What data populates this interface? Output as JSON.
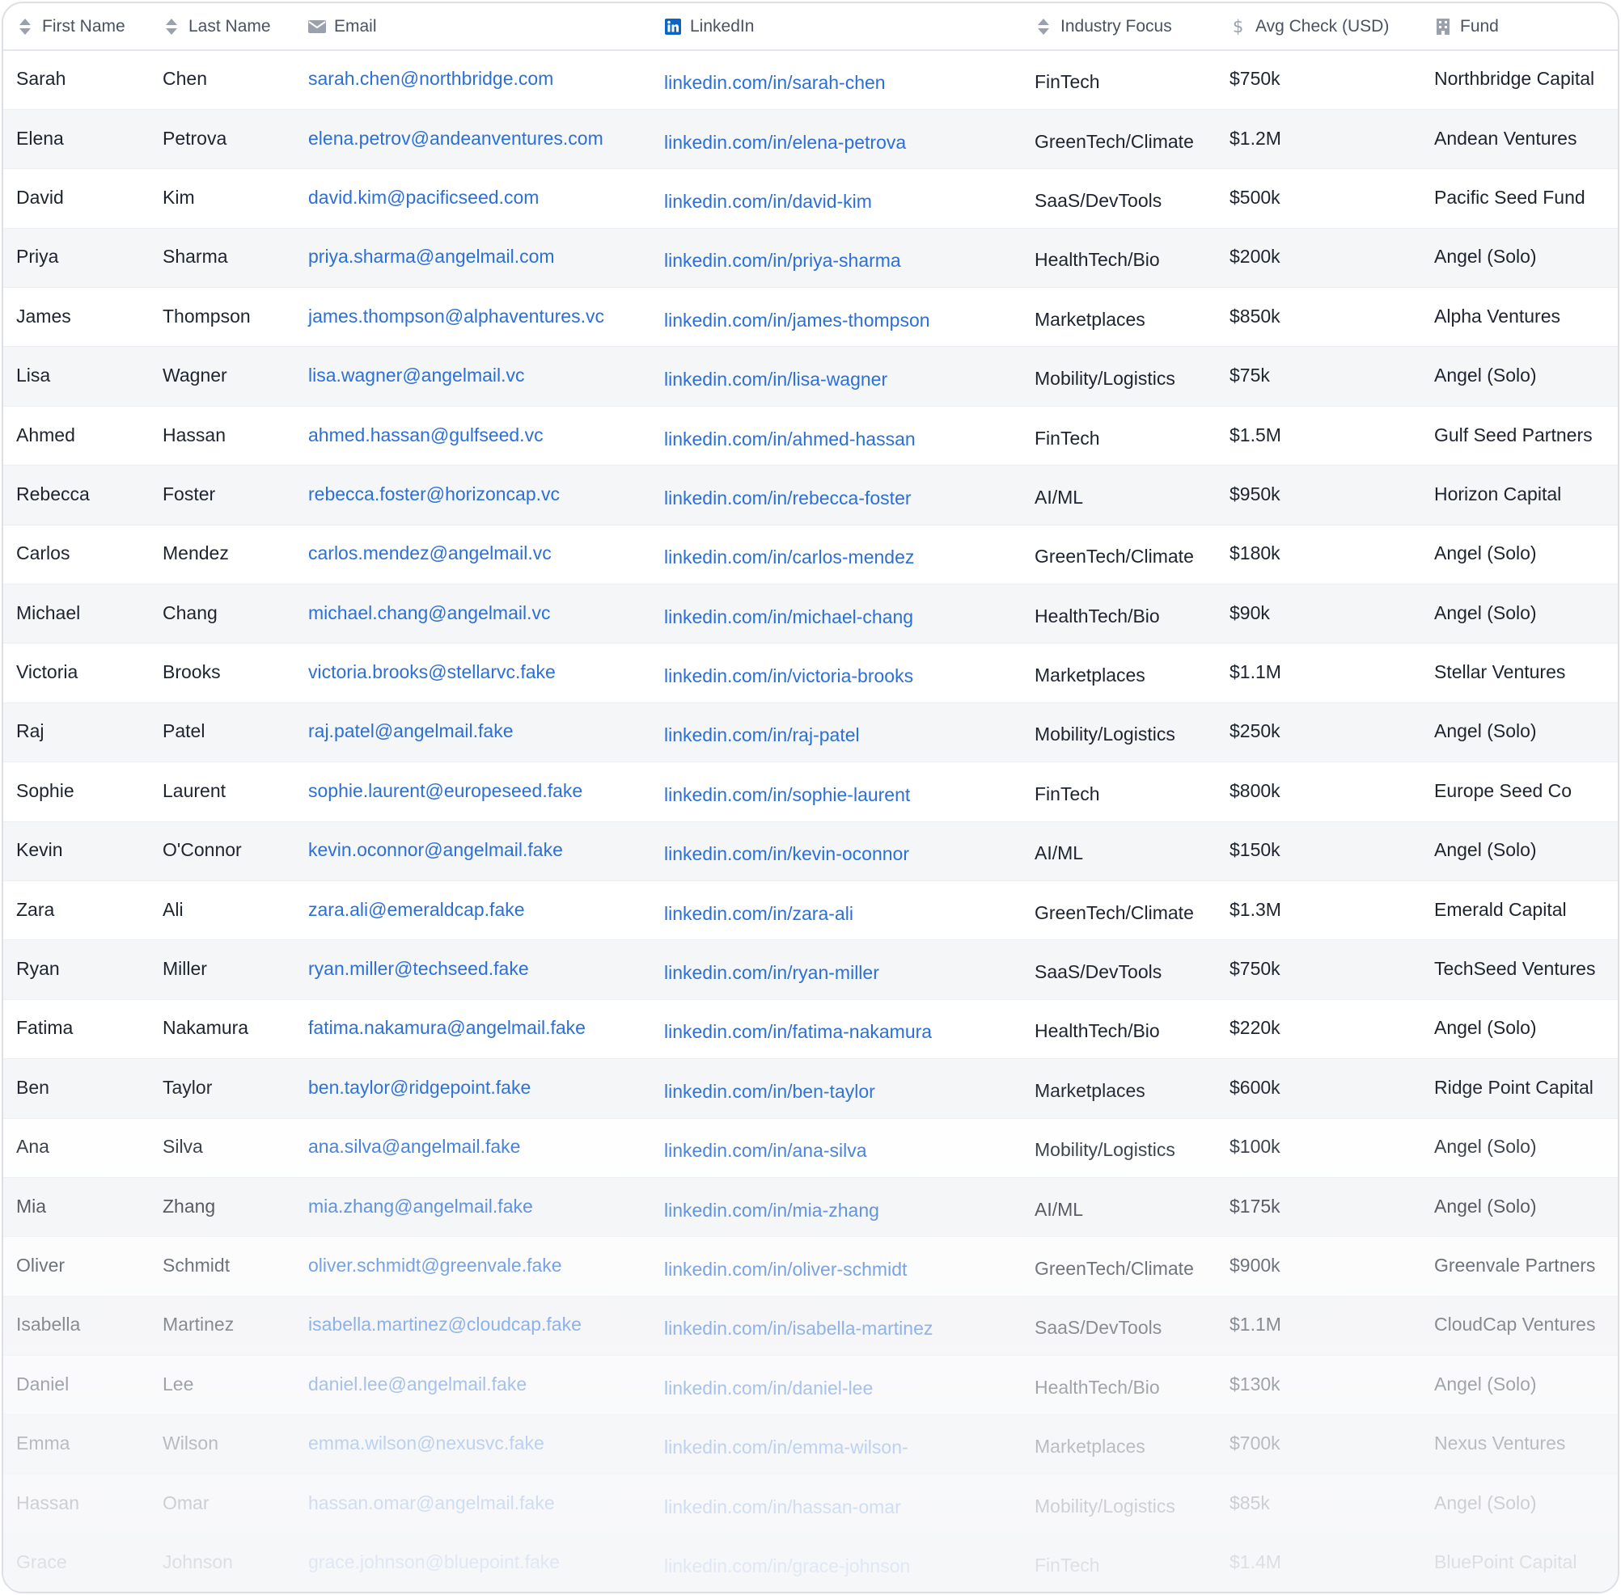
{
  "columns": {
    "first_name": "First Name",
    "last_name": "Last Name",
    "email": "Email",
    "linkedin": "LinkedIn",
    "industry": "Industry Focus",
    "avg_check": "Avg Check (USD)",
    "fund": "Fund"
  },
  "icons": {
    "first_name": "sort-icon",
    "last_name": "sort-icon",
    "email": "envelope-icon",
    "linkedin": "linkedin-icon",
    "industry": "sort-icon",
    "avg_check": "dollar-icon",
    "fund": "building-icon"
  },
  "colors": {
    "link": "#2c6fd6",
    "linkedin_brand": "#0a66c2",
    "header_text": "#4a5260",
    "row_stripe": "#f5f6f8"
  },
  "rows": [
    {
      "first": "Sarah",
      "last": "Chen",
      "email": "sarah.chen@northbridge.com",
      "linkedin": "linkedin.com/in/sarah-chen",
      "industry": "FinTech",
      "avg": "$750k",
      "fund": "Northbridge Capital"
    },
    {
      "first": "Elena",
      "last": "Petrova",
      "email": "elena.petrov@andeanventures.com",
      "linkedin": "linkedin.com/in/elena-petrova",
      "industry": "GreenTech/Climate",
      "avg": "$1.2M",
      "fund": "Andean Ventures"
    },
    {
      "first": "David",
      "last": "Kim",
      "email": "david.kim@pacificseed.com",
      "linkedin": "linkedin.com/in/david-kim",
      "industry": "SaaS/DevTools",
      "avg": "$500k",
      "fund": "Pacific Seed Fund"
    },
    {
      "first": "Priya",
      "last": "Sharma",
      "email": "priya.sharma@angelmail.com",
      "linkedin": "linkedin.com/in/priya-sharma",
      "industry": "HealthTech/Bio",
      "avg": "$200k",
      "fund": "Angel (Solo)"
    },
    {
      "first": "James",
      "last": "Thompson",
      "email": "james.thompson@alphaventures.vc",
      "linkedin": "linkedin.com/in/james-thompson",
      "industry": "Marketplaces",
      "avg": "$850k",
      "fund": "Alpha Ventures"
    },
    {
      "first": "Lisa",
      "last": "Wagner",
      "email": "lisa.wagner@angelmail.vc",
      "linkedin": "linkedin.com/in/lisa-wagner",
      "industry": "Mobility/Logistics",
      "avg": "$75k",
      "fund": "Angel (Solo)"
    },
    {
      "first": "Ahmed",
      "last": "Hassan",
      "email": "ahmed.hassan@gulfseed.vc",
      "linkedin": "linkedin.com/in/ahmed-hassan",
      "industry": "FinTech",
      "avg": "$1.5M",
      "fund": "Gulf Seed Partners"
    },
    {
      "first": "Rebecca",
      "last": "Foster",
      "email": "rebecca.foster@horizoncap.vc",
      "linkedin": "linkedin.com/in/rebecca-foster",
      "industry": "AI/ML",
      "avg": "$950k",
      "fund": "Horizon Capital"
    },
    {
      "first": "Carlos",
      "last": "Mendez",
      "email": "carlos.mendez@angelmail.vc",
      "linkedin": "linkedin.com/in/carlos-mendez",
      "industry": "GreenTech/Climate",
      "avg": "$180k",
      "fund": "Angel (Solo)"
    },
    {
      "first": "Michael",
      "last": "Chang",
      "email": "michael.chang@angelmail.vc",
      "linkedin": "linkedin.com/in/michael-chang",
      "industry": "HealthTech/Bio",
      "avg": "$90k",
      "fund": "Angel (Solo)"
    },
    {
      "first": "Victoria",
      "last": "Brooks",
      "email": "victoria.brooks@stellarvc.fake",
      "linkedin": "linkedin.com/in/victoria-brooks",
      "industry": "Marketplaces",
      "avg": "$1.1M",
      "fund": "Stellar Ventures"
    },
    {
      "first": "Raj",
      "last": "Patel",
      "email": "raj.patel@angelmail.fake",
      "linkedin": "linkedin.com/in/raj-patel",
      "industry": "Mobility/Logistics",
      "avg": "$250k",
      "fund": "Angel (Solo)"
    },
    {
      "first": "Sophie",
      "last": "Laurent",
      "email": "sophie.laurent@europeseed.fake",
      "linkedin": "linkedin.com/in/sophie-laurent",
      "industry": "FinTech",
      "avg": "$800k",
      "fund": "Europe Seed Co"
    },
    {
      "first": "Kevin",
      "last": "O'Connor",
      "email": "kevin.oconnor@angelmail.fake",
      "linkedin": "linkedin.com/in/kevin-oconnor",
      "industry": "AI/ML",
      "avg": "$150k",
      "fund": "Angel (Solo)"
    },
    {
      "first": "Zara",
      "last": "Ali",
      "email": "zara.ali@emeraldcap.fake",
      "linkedin": "linkedin.com/in/zara-ali",
      "industry": "GreenTech/Climate",
      "avg": "$1.3M",
      "fund": "Emerald Capital"
    },
    {
      "first": "Ryan",
      "last": "Miller",
      "email": "ryan.miller@techseed.fake",
      "linkedin": "linkedin.com/in/ryan-miller",
      "industry": "SaaS/DevTools",
      "avg": "$750k",
      "fund": "TechSeed Ventures"
    },
    {
      "first": "Fatima",
      "last": "Nakamura",
      "email": "fatima.nakamura@angelmail.fake",
      "linkedin": "linkedin.com/in/fatima-nakamura",
      "industry": "HealthTech/Bio",
      "avg": "$220k",
      "fund": "Angel (Solo)"
    },
    {
      "first": "Ben",
      "last": "Taylor",
      "email": "ben.taylor@ridgepoint.fake",
      "linkedin": "linkedin.com/in/ben-taylor",
      "industry": "Marketplaces",
      "avg": "$600k",
      "fund": "Ridge Point Capital"
    },
    {
      "first": "Ana",
      "last": "Silva",
      "email": "ana.silva@angelmail.fake",
      "linkedin": "linkedin.com/in/ana-silva",
      "industry": "Mobility/Logistics",
      "avg": "$100k",
      "fund": "Angel (Solo)"
    },
    {
      "first": "Mia",
      "last": "Zhang",
      "email": "mia.zhang@angelmail.fake",
      "linkedin": "linkedin.com/in/mia-zhang",
      "industry": "AI/ML",
      "avg": "$175k",
      "fund": "Angel (Solo)"
    },
    {
      "first": "Oliver",
      "last": "Schmidt",
      "email": "oliver.schmidt@greenvale.fake",
      "linkedin": "linkedin.com/in/oliver-schmidt",
      "industry": "GreenTech/Climate",
      "avg": "$900k",
      "fund": "Greenvale Partners"
    },
    {
      "first": "Isabella",
      "last": "Martinez",
      "email": "isabella.martinez@cloudcap.fake",
      "linkedin": "linkedin.com/in/isabella-martinez",
      "industry": "SaaS/DevTools",
      "avg": "$1.1M",
      "fund": "CloudCap Ventures"
    },
    {
      "first": "Daniel",
      "last": "Lee",
      "email": "daniel.lee@angelmail.fake",
      "linkedin": "linkedin.com/in/daniel-lee",
      "industry": "HealthTech/Bio",
      "avg": "$130k",
      "fund": "Angel (Solo)"
    },
    {
      "first": "Emma",
      "last": "Wilson",
      "email": "emma.wilson@nexusvc.fake",
      "linkedin": "linkedin.com/in/emma-wilson-",
      "industry": "Marketplaces",
      "avg": "$700k",
      "fund": "Nexus Ventures"
    },
    {
      "first": "Hassan",
      "last": "Omar",
      "email": "hassan.omar@angelmail.fake",
      "linkedin": "linkedin.com/in/hassan-omar",
      "industry": "Mobility/Logistics",
      "avg": "$85k",
      "fund": "Angel (Solo)"
    },
    {
      "first": "Grace",
      "last": "Johnson",
      "email": "grace.johnson@bluepoint.fake",
      "linkedin": "linkedin.com/in/grace-johnson",
      "industry": "FinTech",
      "avg": "$1.4M",
      "fund": "BluePoint Capital"
    }
  ]
}
